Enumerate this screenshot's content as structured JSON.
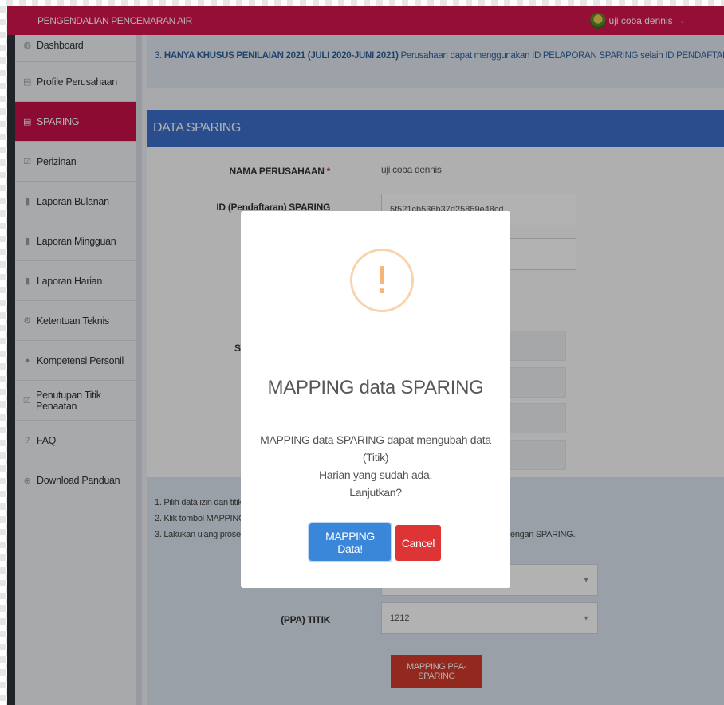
{
  "header": {
    "app_title": "PENGENDALIAN PENCEMARAN AIR",
    "user_name": "uji coba dennis"
  },
  "sidebar": {
    "items": [
      {
        "label": "Dashboard",
        "icon": "dashboard-icon"
      },
      {
        "label": "Profile Perusahaan",
        "icon": "building-icon"
      },
      {
        "label": "SPARING",
        "icon": "building-icon",
        "active": true
      },
      {
        "label": "Perizinan",
        "icon": "checkbox-icon"
      },
      {
        "label": "Laporan Bulanan",
        "icon": "book-icon"
      },
      {
        "label": "Laporan Mingguan",
        "icon": "book-icon"
      },
      {
        "label": "Laporan Harian",
        "icon": "book-icon"
      },
      {
        "label": "Ketentuan Teknis",
        "icon": "gears-icon"
      },
      {
        "label": "Kompetensi Personil",
        "icon": "user-icon"
      },
      {
        "label": "Penutupan Titik Penaatan",
        "icon": "checkbox-icon"
      },
      {
        "label": "FAQ",
        "icon": "question-icon"
      },
      {
        "label": "Download Panduan",
        "icon": "download-icon"
      }
    ]
  },
  "notice": {
    "prefix": "3. ",
    "bold": "HANYA KHUSUS PENILAIAN 2021 (JULI 2020-JUNI 2021)",
    "text": " Perusahaan dapat menggunakan ID PELAPORAN SPARING selain ID PENDAFTARAN."
  },
  "panel": {
    "title": "DATA SPARING"
  },
  "form": {
    "nama_label": "NAMA PERUSAHAAN",
    "nama_required": "*",
    "nama_value": "uji coba dennis",
    "id_label": "ID (Pendaftaran) SPARING",
    "id_value": "5f521cb536b37d25859e48cd",
    "partial_label": "ST"
  },
  "info": {
    "line1": "1. Pilih data izin dan titik",
    "line2": "2. Klik tombol MAPPING",
    "line3": "3. Lakukan ulang proses",
    "line3_tail": "engan SPARING.",
    "ppa_label": "(PPA) TITIK",
    "ppa_value": "1212",
    "mapping_button": "MAPPING PPA-SPARING"
  },
  "modal": {
    "icon": "warning-icon",
    "title": "MAPPING data SPARING",
    "text_line1": "MAPPING data SPARING dapat mengubah data (Titik)",
    "text_line2": "Harian yang sudah ada.",
    "text_line3": "Lanjutkan?",
    "confirm_label": "MAPPING Data!",
    "cancel_label": "Cancel"
  },
  "colors": {
    "header": "#d5154e",
    "panel": "#3b6fcb",
    "confirm": "#3a86d9",
    "cancel": "#dd3535",
    "warning": "#f4b576"
  }
}
